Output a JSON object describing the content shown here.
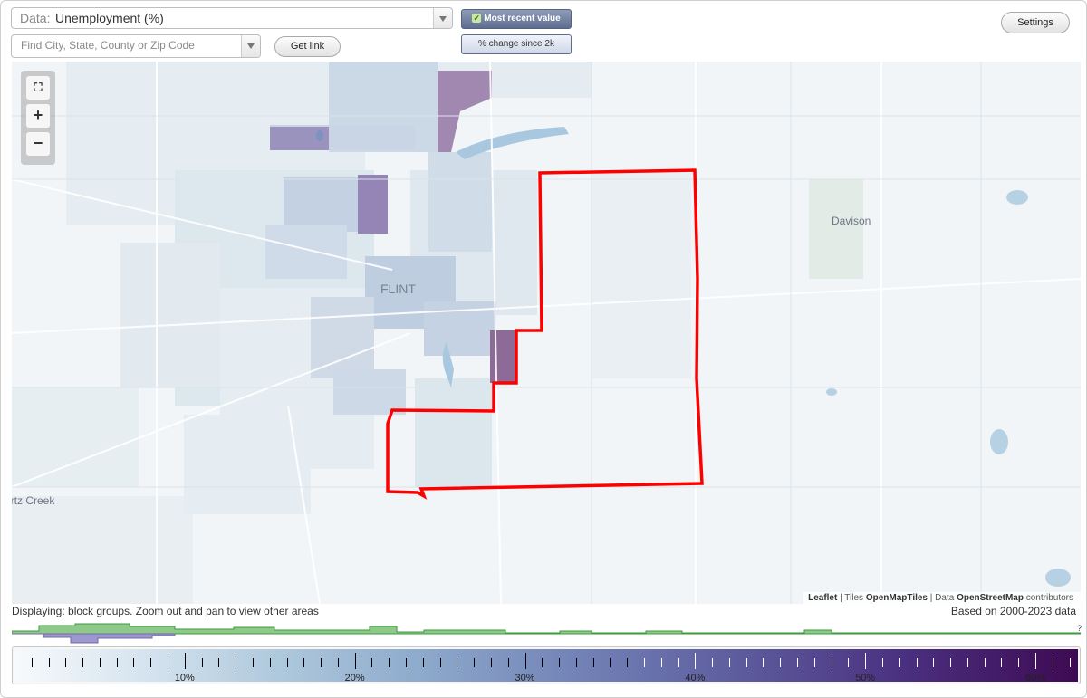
{
  "controls": {
    "data_label": "Data:",
    "data_value": "Unemployment (%)",
    "search_placeholder": "Find City, State, County or Zip Code",
    "get_link": "Get link",
    "most_recent": "Most recent value",
    "change_since": "% change since 2k",
    "settings": "Settings"
  },
  "map": {
    "places": {
      "flint": "FLINT",
      "davison": "Davison",
      "swartz_creek": "artz Creek"
    },
    "attribution": {
      "leaflet": "Leaflet",
      "sep1": " | Tiles ",
      "tiles": "OpenMapTiles",
      "sep2": " | Data ",
      "data": "OpenStreetMap",
      "suffix": " contributors"
    },
    "colors": {
      "highlight_outline": "#ff0000",
      "water": "#a9c8e0",
      "roads": "#ffffff",
      "high_value": "#8e6a98"
    }
  },
  "footer": {
    "displaying": "Displaying: block groups. Zoom out and pan to view other areas",
    "based_on": "Based on 2000-2023 data",
    "unknown_mark": "?"
  },
  "legend": {
    "ticks": [
      "10%",
      "20%",
      "30%",
      "40%",
      "50%",
      "60%"
    ],
    "scale_min": 0,
    "scale_max": 62.5,
    "colors": [
      "#f7fafc",
      "#aec8dc",
      "#7485b8",
      "#5d5c9e",
      "#3e0a52"
    ]
  }
}
